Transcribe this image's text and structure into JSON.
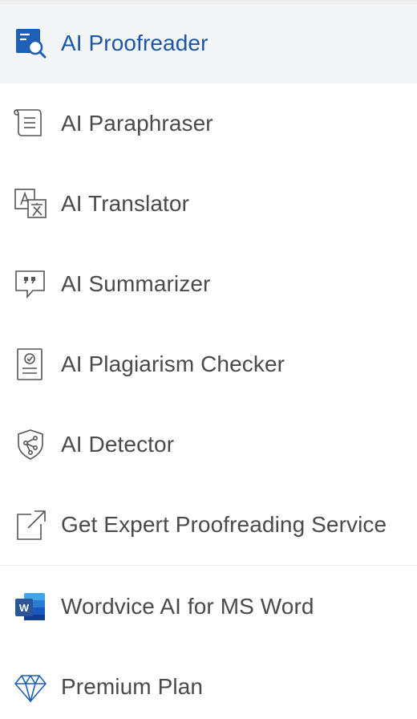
{
  "menu": {
    "items": [
      {
        "label": "AI Proofreader",
        "icon": "proofreader-search-icon",
        "active": true
      },
      {
        "label": "AI Paraphraser",
        "icon": "document-lines-icon"
      },
      {
        "label": "AI Translator",
        "icon": "translate-icon"
      },
      {
        "label": "AI Summarizer",
        "icon": "speech-bubble-quote-icon"
      },
      {
        "label": "AI Plagiarism Checker",
        "icon": "document-check-icon"
      },
      {
        "label": "AI Detector",
        "icon": "shield-network-icon"
      },
      {
        "label": "Get Expert Proofreading Service",
        "icon": "external-link-icon"
      }
    ],
    "secondary_items": [
      {
        "label": "Wordvice AI for MS Word",
        "icon": "ms-word-icon",
        "icon_text": "W"
      },
      {
        "label": "Premium Plan",
        "icon": "diamond-icon"
      }
    ]
  },
  "colors": {
    "active_text": "#1b56a8",
    "active_bg": "#f4f5f7",
    "text": "#4a4a4a",
    "icon_blue": "#1f5fb5",
    "word_blue": "#2b579a"
  }
}
